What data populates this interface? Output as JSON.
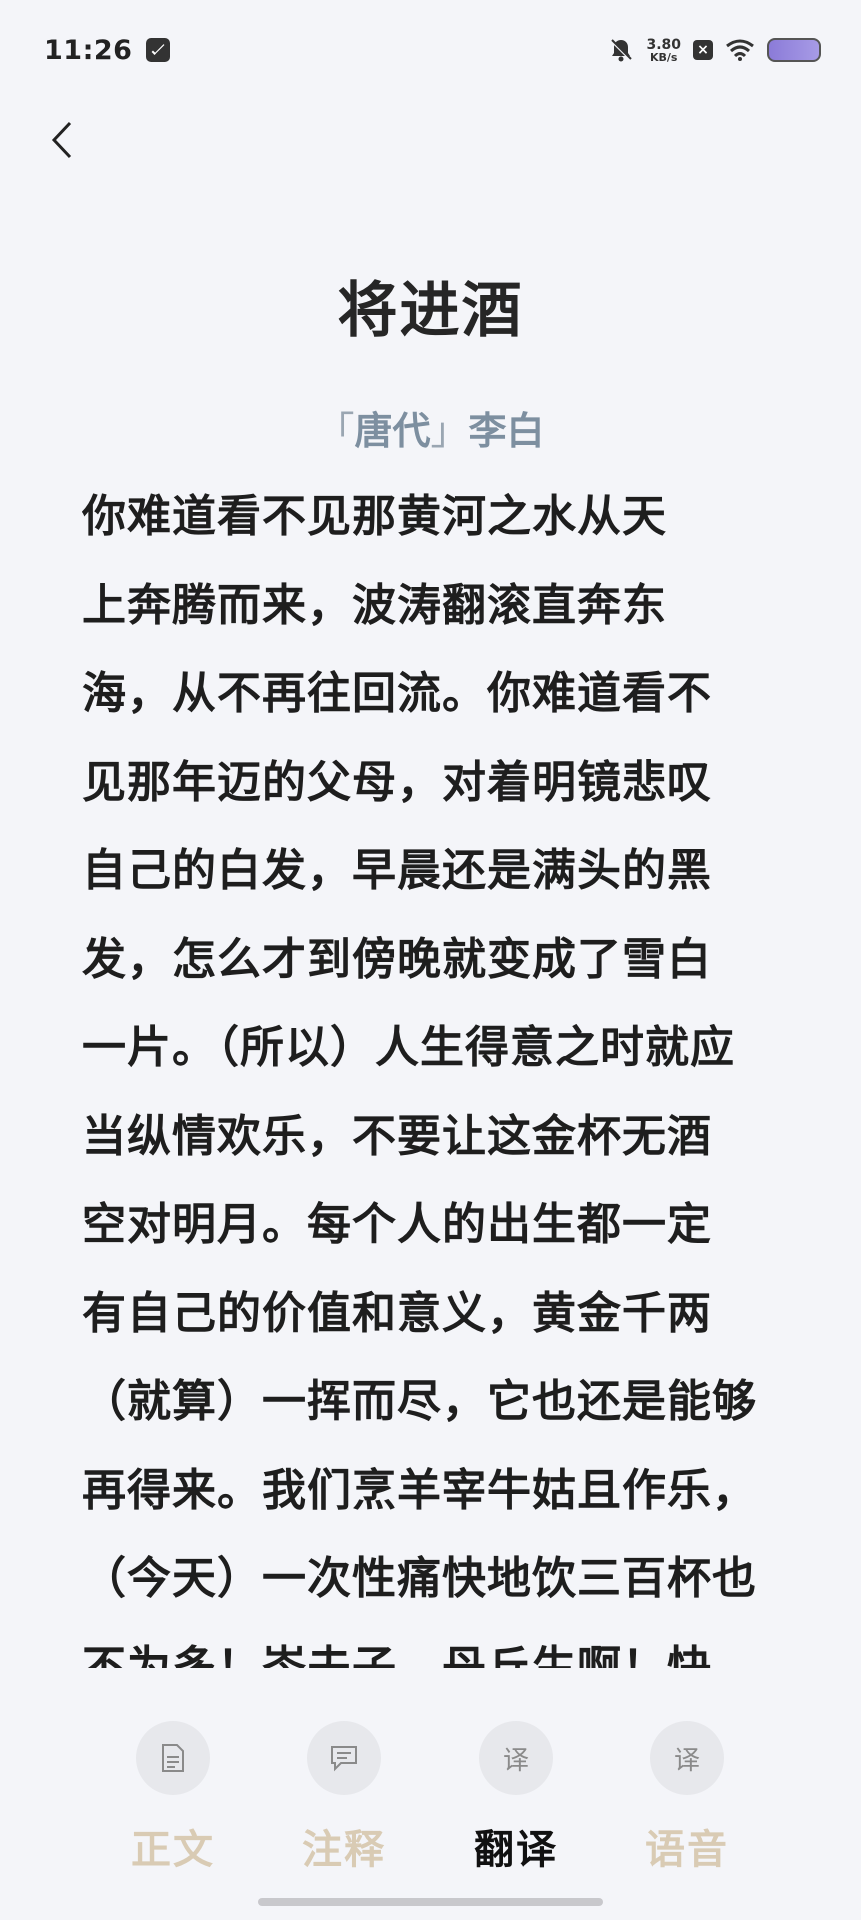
{
  "status_bar": {
    "time": "11:26",
    "speed_value": "3.80",
    "speed_unit": "KB/s",
    "x_badge": "×"
  },
  "poem": {
    "title": "将进酒",
    "dynasty_open": "「",
    "dynasty": "唐代",
    "dynasty_close": "」",
    "author": "李白"
  },
  "translation_lines": [
    "你难道看不见那黄河之水从天",
    "上奔腾而来，波涛翻滚直奔东",
    "海，从不再往回流。你难道看不",
    "见那年迈的父母，对着明镜悲叹",
    "自己的白发，早晨还是满头的黑",
    "发，怎么才到傍晚就变成了雪白",
    "一片。（所以）人生得意之时就应",
    "当纵情欢乐，不要让这金杯无酒",
    "空对明月。每个人的出生都一定",
    "有自己的价值和意义，黄金千两",
    "（就算）一挥而尽，它也还是能够",
    "再得来。我们烹羊宰牛姑且作乐，",
    "（今天）一次性痛快地饮三百杯也",
    "不为多！岑夫子，丹丘生啊！快"
  ],
  "tabs": [
    {
      "label": "正文",
      "icon": "doc-icon",
      "glyph": "▤",
      "active": false
    },
    {
      "label": "注释",
      "icon": "comment-icon",
      "glyph": "▭",
      "active": false
    },
    {
      "label": "翻译",
      "icon": "translate-icon",
      "glyph": "译",
      "active": true
    },
    {
      "label": "语音",
      "icon": "audio-icon",
      "glyph": "译",
      "active": false
    }
  ],
  "colors": {
    "background": "#f4f5f9",
    "meta": "#7d8fa0",
    "tab_inactive": "#d9cbb4",
    "tab_active": "#111111"
  }
}
